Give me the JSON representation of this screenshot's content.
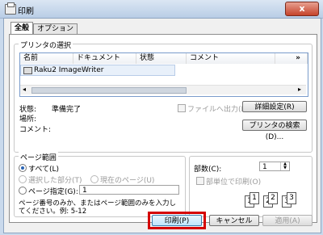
{
  "window": {
    "title": "印刷",
    "close_label": "x"
  },
  "tabs": [
    {
      "label": "全般"
    },
    {
      "label": "オプション"
    }
  ],
  "printer_select": {
    "group_label": "プリンタの選択",
    "columns": [
      "名前",
      "ドキュメント",
      "状態",
      "コメント"
    ],
    "more_label": "»",
    "printers": [
      {
        "name": "Raku2 ImageWriter"
      }
    ]
  },
  "status": {
    "state_label": "状態:",
    "state_value": "準備完了",
    "location_label": "場所:",
    "comment_label": "コメント:",
    "print_to_file_label": "ファイルへ出力(F)",
    "settings_button": "詳細設定(R)",
    "find_printer_button": "プリンタの検索(D)..."
  },
  "page_range": {
    "group_label": "ページ範囲",
    "all_label": "すべて(L)",
    "selection_label": "選択した部分(T)",
    "current_label": "現在のページ(U)",
    "pages_label": "ページ指定(G):",
    "pages_value": "1",
    "hint_line1": "ページ番号のみか、またはページ範囲のみを入力し",
    "hint_line2": "てください。例: 5-12"
  },
  "copies": {
    "label": "部数(C):",
    "value": "1",
    "collate_label": "部単位で印刷(O)",
    "collate_pages": [
      "1",
      "1",
      "2",
      "2",
      "3",
      "3"
    ]
  },
  "footer": {
    "print_button": "印刷(P)",
    "cancel_button": "キャンセル",
    "apply_button": "適用(A)"
  },
  "colors": {
    "highlight": "#d40000",
    "accent": "#2a64b4"
  }
}
